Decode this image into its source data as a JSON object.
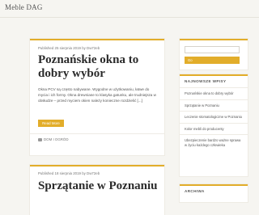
{
  "site": {
    "title": "Meble DAG"
  },
  "posts": [
    {
      "meta": "Published 25 sierpnia 2019 by Dw72eb",
      "title": "Poznańskie okna to dobry wybór",
      "excerpt": "Okna PCV są często nabywane. Wygodne w użytkowaniu, łatwe do mycia i ich formy. Okna drewniane to klasyka gatunku, ale trudniejsza w obsłudze – przed myciem okien należy konieczne rozdzielić [...]",
      "read_more": "Read More",
      "category": "DOM I OGRÓD"
    },
    {
      "meta": "Published 18 sierpnia 2019 by Dw72eb",
      "title": "Sprzątanie w Poznaniu"
    }
  ],
  "sidebar": {
    "search_button": "Go",
    "recent": {
      "title": "NAJNOWSZE WPISY",
      "items": [
        "Poznańskie okna to dobry wybór",
        "Sprzątanie w Poznaniu",
        "Leczenie stomatologiczne w Poznaniu",
        "Kolor mebli do producenty",
        "Ubezpieczenie bardzo ważne sprawa w życiu każdego człowieka"
      ]
    },
    "archive": {
      "title": "ARCHIWA"
    }
  },
  "colors": {
    "accent": "#e2ad2a",
    "background": "#f6f5f1"
  }
}
